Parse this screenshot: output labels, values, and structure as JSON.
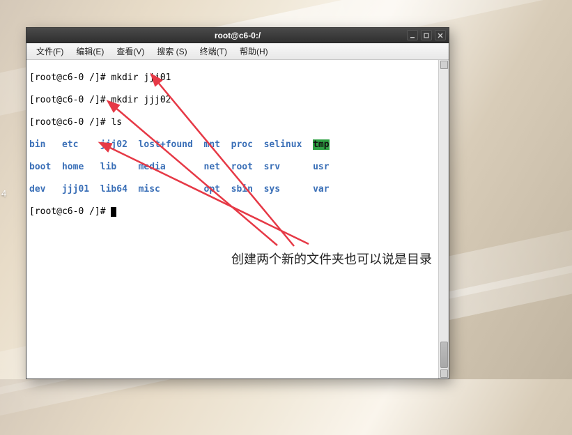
{
  "desktop": {
    "taskbar_num": "4"
  },
  "window": {
    "title": "root@c6-0:/",
    "controls": {
      "min": "_",
      "max": "□",
      "close": "×"
    }
  },
  "menu": {
    "file": "文件(F)",
    "edit": "编辑(E)",
    "view": "查看(V)",
    "search": "搜索 (S)",
    "terminal": "终端(T)",
    "help": "帮助(H)"
  },
  "terminal": {
    "prompt1": "[root@c6-0 /]# mkdir jjj01",
    "prompt2": "[root@c6-0 /]# mkdir jjj02",
    "prompt3": "[root@c6-0 /]# ls",
    "ls": {
      "r1": {
        "c1": "bin",
        "c2": "etc",
        "c3": "jjj02",
        "c4": "lost+found",
        "c5": "mnt",
        "c6": "proc",
        "c7": "selinux",
        "c8": "tmp"
      },
      "r2": {
        "c1": "boot",
        "c2": "home",
        "c3": "lib",
        "c4": "media",
        "c5": "net",
        "c6": "root",
        "c7": "srv",
        "c8": "usr"
      },
      "r3": {
        "c1": "dev",
        "c2": "jjj01",
        "c3": "lib64",
        "c4": "misc",
        "c5": "opt",
        "c6": "sbin",
        "c7": "sys",
        "c8": "var"
      }
    },
    "prompt4_pre": "[root@c6-0 /]# "
  },
  "annotation": {
    "text": "创建两个新的文件夹也可以说是目录"
  }
}
